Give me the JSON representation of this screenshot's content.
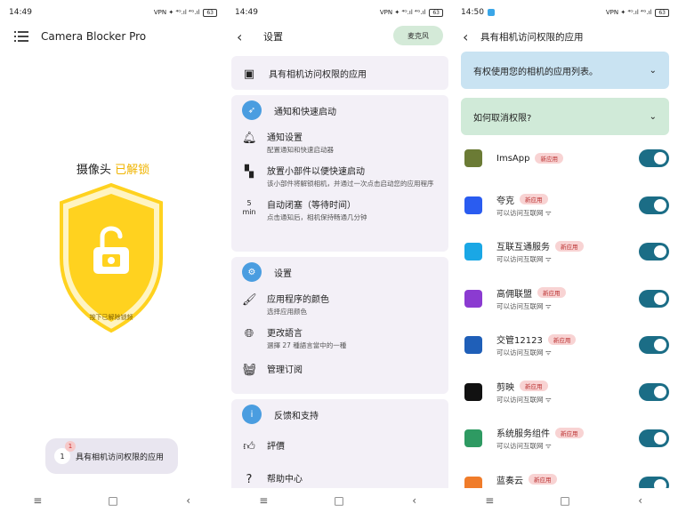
{
  "panel1": {
    "status": {
      "time": "14:49",
      "icons": "VPN ✦ ⁴ᴳ.ıl ⁴ᴳ.ıl",
      "battery": "63"
    },
    "app_title": "Camera Blocker Pro",
    "camera_label": "摄像头",
    "camera_state": "已解锁",
    "shield_text": "按下已解除锁频",
    "pill": {
      "count": "1",
      "badge": "1",
      "label": "具有相机访问权限的应用"
    }
  },
  "panel2": {
    "status": {
      "time": "14:49",
      "icons": "VPN ✦ ⁴ᴳ.ıl ⁴ᴳ.ıl",
      "battery": "63"
    },
    "title": "设置",
    "top_button": "麦克风",
    "item_camera_apps": "具有相机访问权限的应用",
    "section_notify": {
      "header": "通知和快速启动",
      "rows": [
        {
          "title": "通知设置",
          "sub": "配置通知和快速启动器"
        },
        {
          "title": "放置小部件以便快速启动",
          "sub": "该小部件将解锁相机，并通过一次点击启动您的应用程序"
        },
        {
          "title": "自动闭塞（等待时间）",
          "sub": "点击通知后，相机保持畅通几分钟",
          "icon_text": "5\nmin"
        }
      ]
    },
    "section_settings": {
      "header": "设置",
      "rows": [
        {
          "title": "应用程序的颜色",
          "sub": "选择应用颜色"
        },
        {
          "title": "更改語言",
          "sub": "選擇 27 種語言當中的一種"
        },
        {
          "title": "管理订阅",
          "sub": ""
        }
      ]
    },
    "section_feedback": {
      "header": "反馈和支持",
      "rows": [
        {
          "title": "評價"
        },
        {
          "title": "帮助中心"
        }
      ]
    }
  },
  "panel3": {
    "status": {
      "time": "14:50",
      "icons": "VPN ✦ ⁴ᴳ.ıl ⁴ᴳ.ıl",
      "battery": "63"
    },
    "title": "具有相机访问权限的应用",
    "accordion1": "有权使用您的相机的应用列表。",
    "accordion2": "如何取消权限?",
    "badge_new": "新应用",
    "internet_text": "可以访问互联网",
    "apps": [
      {
        "name": "ImsApp",
        "internet": false,
        "icon_color": "#6b7b35"
      },
      {
        "name": "夸克",
        "internet": true,
        "icon_color": "#2a5cf0"
      },
      {
        "name": "互联互通服务",
        "internet": true,
        "icon_color": "#1aa7e5"
      },
      {
        "name": "高佣联盟",
        "internet": true,
        "icon_color": "#8b3bd1"
      },
      {
        "name": "交管12123",
        "internet": true,
        "icon_color": "#1f5fb8"
      },
      {
        "name": "剪映",
        "internet": true,
        "icon_color": "#111111"
      },
      {
        "name": "系统服务组件",
        "internet": true,
        "icon_color": "#2e9a62"
      },
      {
        "name": "蓝奏云",
        "internet": true,
        "icon_color": "#f07c2a"
      }
    ],
    "toggle_color": "#1b6d86"
  },
  "colors": {
    "accent_yellow": "#f0b400",
    "shield_yellow": "#ffd21f",
    "card_bg": "#f3f0f7"
  }
}
